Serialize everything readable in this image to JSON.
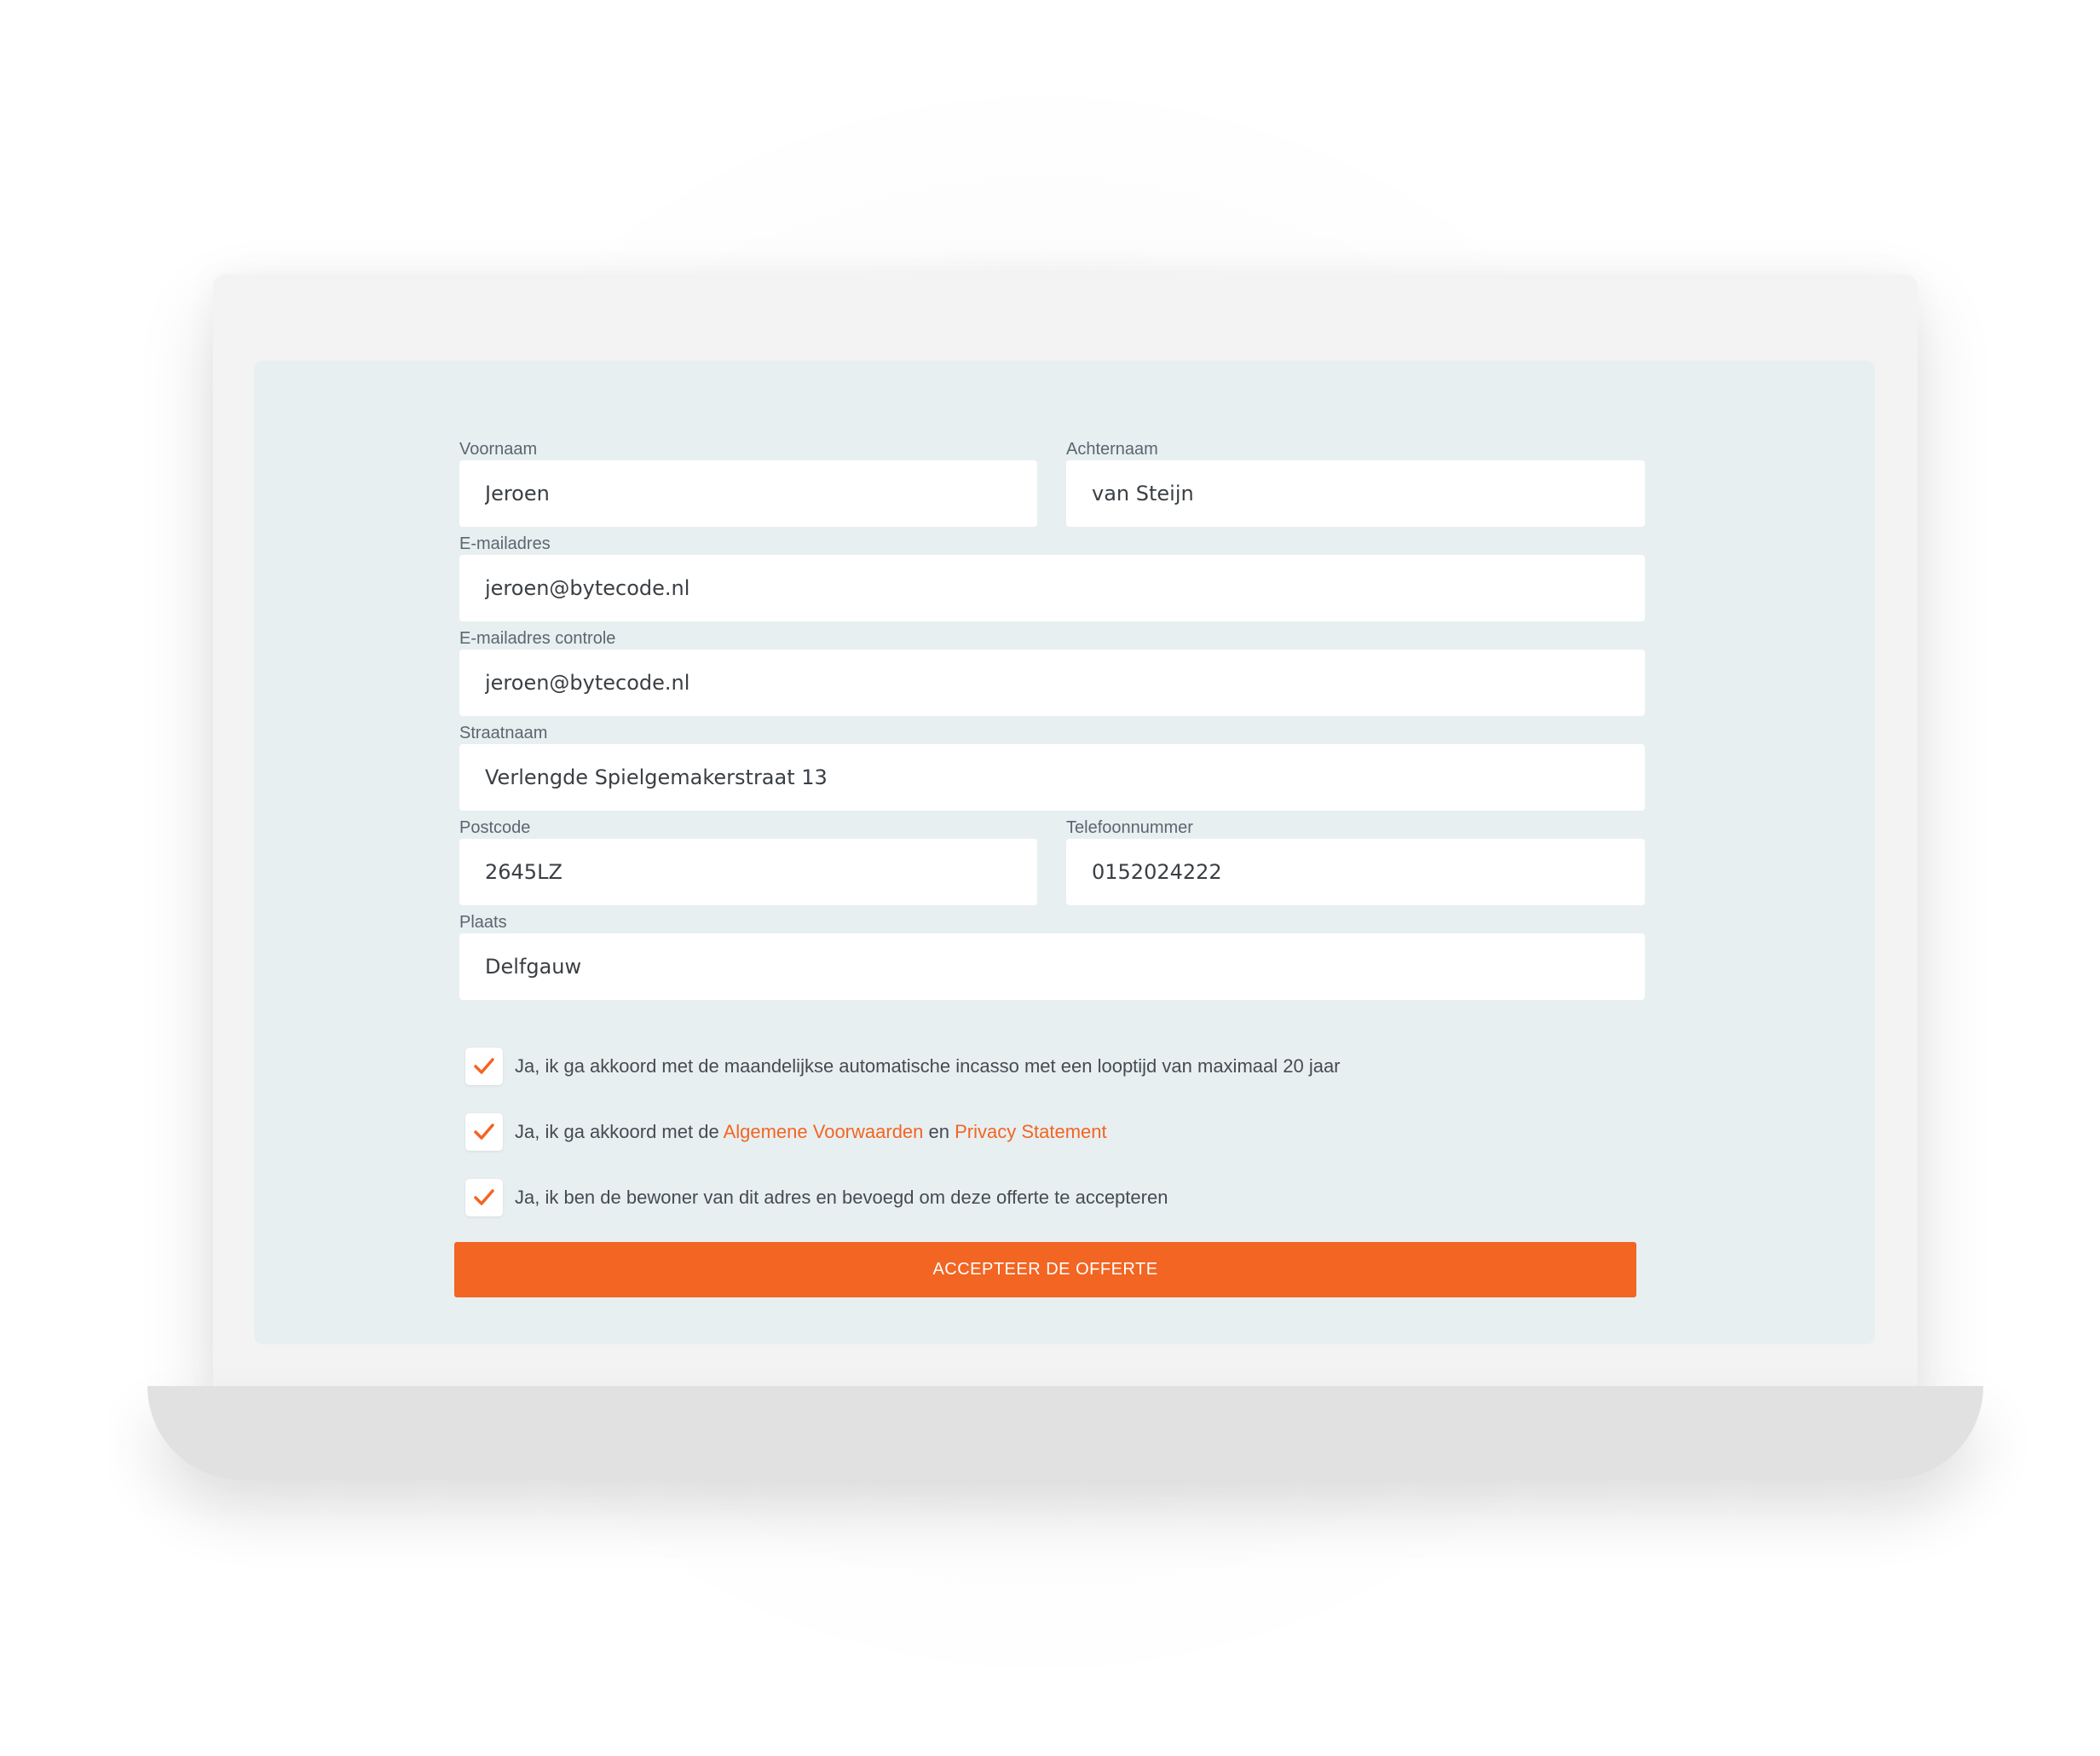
{
  "form": {
    "fields": {
      "voornaam": {
        "label": "Voornaam",
        "value": "Jeroen"
      },
      "achternaam": {
        "label": "Achternaam",
        "value": "van Steijn"
      },
      "email": {
        "label": "E-mailadres",
        "value": "jeroen@bytecode.nl"
      },
      "email_controle": {
        "label": "E-mailadres controle",
        "value": "jeroen@bytecode.nl"
      },
      "straatnaam": {
        "label": "Straatnaam",
        "value": "Verlengde Spielgemakerstraat 13"
      },
      "postcode": {
        "label": "Postcode",
        "value": "2645LZ"
      },
      "telefoonnummer": {
        "label": "Telefoonnummer",
        "value": "0152024222"
      },
      "plaats": {
        "label": "Plaats",
        "value": "Delfgauw"
      }
    },
    "checkboxes": {
      "incasso": {
        "text": "Ja, ik ga akkoord met de maandelijkse automatische incasso met een looptijd van maximaal 20 jaar",
        "checked": true
      },
      "voorwaarden": {
        "text_before": "Ja, ik ga akkoord met de ",
        "link1": "Algemene Voorwaarden",
        "text_middle": " en ",
        "link2": "Privacy Statement",
        "checked": true
      },
      "bewoner": {
        "text": "Ja, ik ben de bewoner van dit adres en bevoegd om deze offerte te accepteren",
        "checked": true
      }
    },
    "submit_label": "ACCEPTEER DE OFFERTE"
  },
  "colors": {
    "accent": "#f26522",
    "panel": "#e8eff1",
    "screen": "#f3f3f3",
    "base": "#e1e1e1"
  },
  "icons": {
    "checkbox_mark": "checkmark-icon"
  }
}
